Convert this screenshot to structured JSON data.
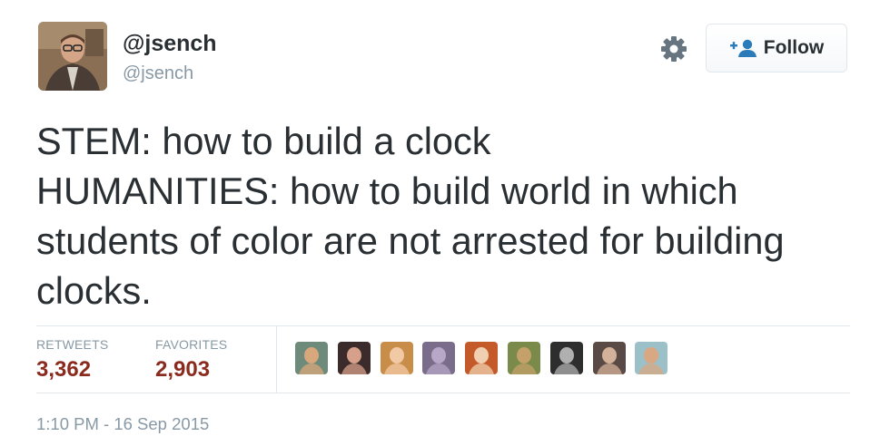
{
  "user": {
    "display_name": "@jsench",
    "handle": "@jsench"
  },
  "follow_button": {
    "label": "Follow",
    "icon": "add-user-icon"
  },
  "settings": {
    "icon": "gear-icon"
  },
  "tweet": {
    "lines": [
      "STEM: how to build a clock",
      "HUMANITIES: how to build world in which",
      "students of color are not arrested for building",
      "clocks."
    ]
  },
  "stats": {
    "retweets_label": "RETWEETS",
    "retweets_value": "3,362",
    "favorites_label": "FAVORITES",
    "favorites_value": "2,903"
  },
  "favoriter_avatars": [
    {
      "name": "favoriter-1",
      "bg": "#6d8a7a",
      "fg": "#d9a77c"
    },
    {
      "name": "favoriter-2",
      "bg": "#3b2b2a",
      "fg": "#d7a08a"
    },
    {
      "name": "favoriter-3",
      "bg": "#c98d4a",
      "fg": "#f1c9a4"
    },
    {
      "name": "favoriter-4",
      "bg": "#7a6d8c",
      "fg": "#b8a7c7"
    },
    {
      "name": "favoriter-5",
      "bg": "#c45a2a",
      "fg": "#f0d0b0"
    },
    {
      "name": "favoriter-6",
      "bg": "#7a8a4a",
      "fg": "#c4a06a"
    },
    {
      "name": "favoriter-7",
      "bg": "#2e2e2e",
      "fg": "#b0b0b0"
    },
    {
      "name": "favoriter-8",
      "bg": "#5a4a45",
      "fg": "#d4b29a"
    },
    {
      "name": "favoriter-9",
      "bg": "#9cc0c8",
      "fg": "#d9a882"
    }
  ],
  "timestamp": "1:10 PM - 16 Sep 2015",
  "colors": {
    "text": "#292f33",
    "muted": "#8899a6",
    "count": "#8a2b1e",
    "follow_icon": "#2b7bb9",
    "border": "#e1e8ed"
  }
}
